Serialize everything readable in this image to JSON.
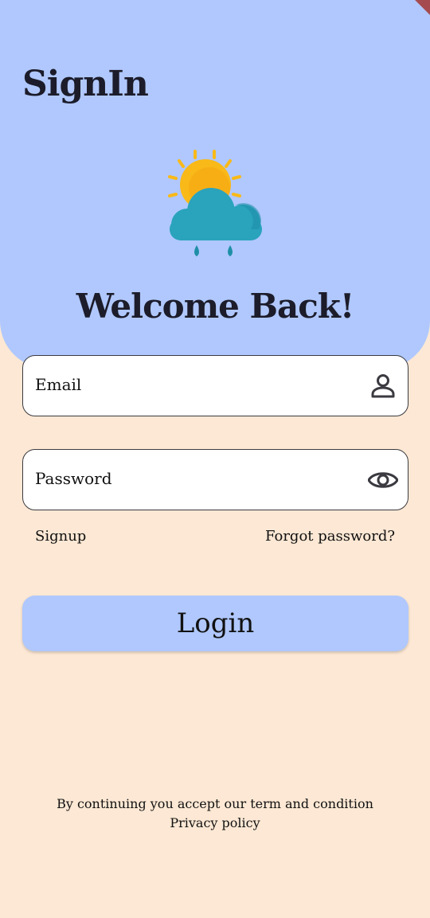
{
  "header": {
    "title": "SignIn",
    "welcome": "Welcome Back!",
    "weather_icon": "sun-cloud-rain-icon"
  },
  "form": {
    "email": {
      "label": "Email",
      "icon": "person-icon"
    },
    "password": {
      "label": "Password",
      "icon": "eye-icon"
    },
    "signup_link": "Signup",
    "forgot_link": "Forgot password?",
    "login_label": "Login"
  },
  "footer": {
    "terms": "By continuing you accept our term and condition",
    "privacy": "Privacy policy"
  },
  "colors": {
    "header_bg": "#b0c8fd",
    "page_bg": "#fce8d4",
    "button_bg": "#b0c8fd",
    "sun": "#f9b918",
    "cloud": "#2aa3bd",
    "rain": "#1f8fa8"
  }
}
